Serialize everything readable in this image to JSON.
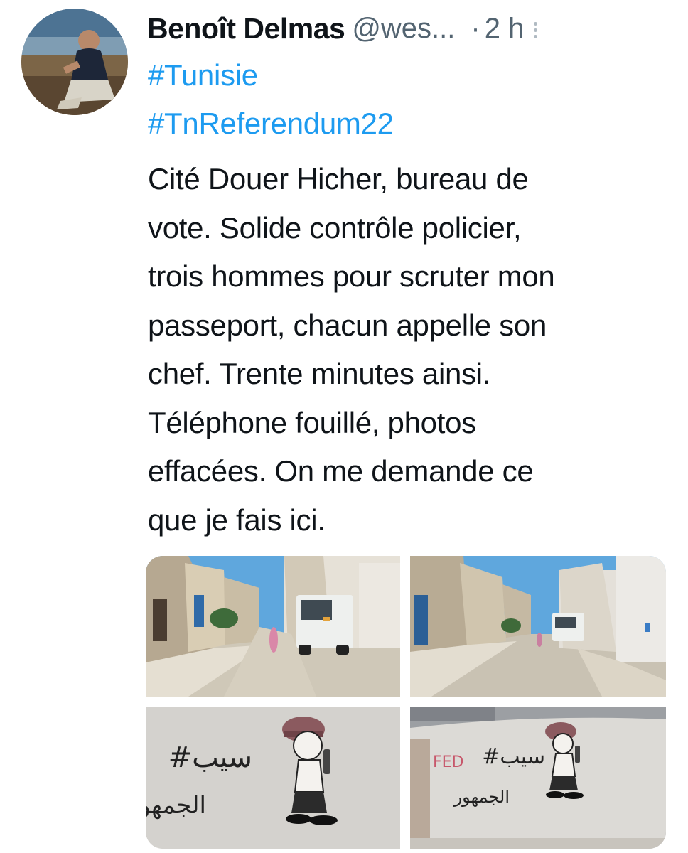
{
  "tweet": {
    "author_name": "Benoît Delmas",
    "author_handle": "@wes...",
    "separator": "·",
    "timestamp": "2 h",
    "hashtags": [
      "#Tunisie",
      "#TnReferendum22"
    ],
    "body_lines": [
      "Cité Douer Hicher, bureau de",
      "vote. Solide contrôle policier,",
      "trois hommes pour scruter mon",
      "passeport, chacun appelle son",
      "chef. Trente minutes ainsi.",
      "Téléphone fouillé, photos",
      "effacées. On me demande ce",
      "que je fais ici."
    ],
    "graffiti": {
      "line1": "#سيب",
      "line2": "الجمهور"
    }
  },
  "colors": {
    "link": "#1d9bf0",
    "text": "#0f1419",
    "muted": "#536471",
    "sky": "#5fa7dd"
  },
  "icons": {
    "more": "vertical-ellipsis-icon"
  }
}
